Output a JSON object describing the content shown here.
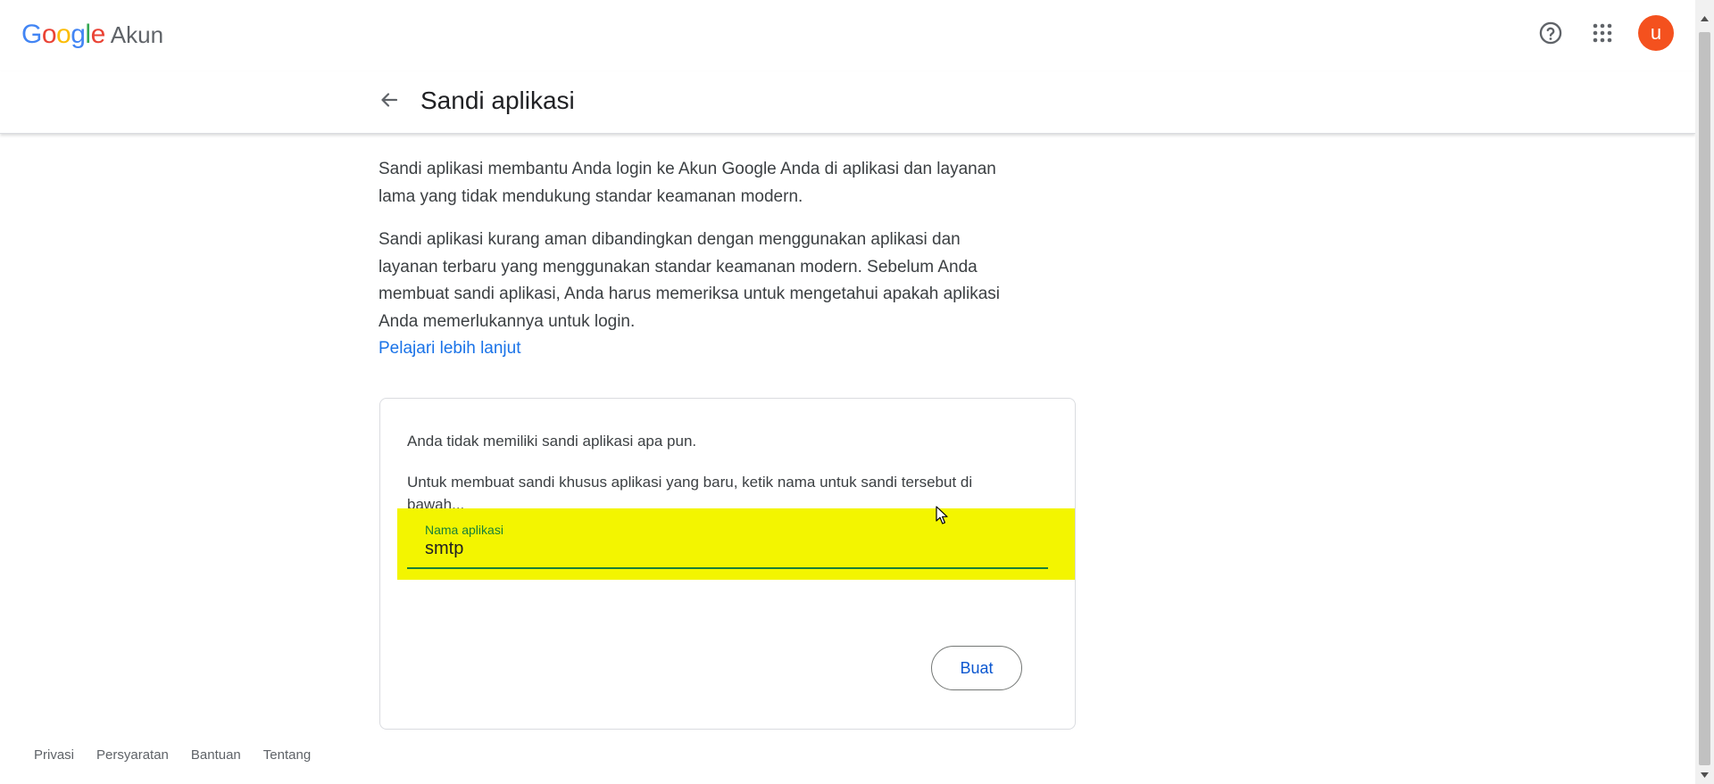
{
  "header": {
    "logo_letters": [
      {
        "char": "G",
        "color": "#4285f4"
      },
      {
        "char": "o",
        "color": "#ea4335"
      },
      {
        "char": "o",
        "color": "#fbbc05"
      },
      {
        "char": "g",
        "color": "#4285f4"
      },
      {
        "char": "l",
        "color": "#34a853"
      },
      {
        "char": "e",
        "color": "#ea4335"
      }
    ],
    "product_name": "Akun",
    "help_icon": "help-circle-icon",
    "apps_icon": "apps-grid-icon",
    "avatar_initial": "u",
    "avatar_color": "#f4511e"
  },
  "page": {
    "title": "Sandi aplikasi",
    "back_icon": "arrow-back-icon"
  },
  "content": {
    "paragraph1": "Sandi aplikasi membantu Anda login ke Akun Google Anda di aplikasi dan layanan lama yang tidak mendukung standar keamanan modern.",
    "paragraph2": "Sandi aplikasi kurang aman dibandingkan dengan menggunakan aplikasi dan layanan terbaru yang menggunakan standar keamanan modern. Sebelum Anda membuat sandi aplikasi, Anda harus memeriksa untuk mengetahui apakah aplikasi Anda memerlukannya untuk login.",
    "learn_more": "Pelajari lebih lanjut",
    "link_color": "#1a73e8"
  },
  "card": {
    "no_passwords_text": "Anda tidak memiliki sandi aplikasi apa pun.",
    "instruction_text": "Untuk membuat sandi khusus aplikasi yang baru, ketik nama untuk sandi tersebut di bawah...",
    "field_label": "Nama aplikasi",
    "field_value": "smtp",
    "create_button": "Buat",
    "highlight_color": "#f3f500",
    "focus_color": "#188038"
  },
  "footer": {
    "links": [
      "Privasi",
      "Persyaratan",
      "Bantuan",
      "Tentang"
    ]
  }
}
